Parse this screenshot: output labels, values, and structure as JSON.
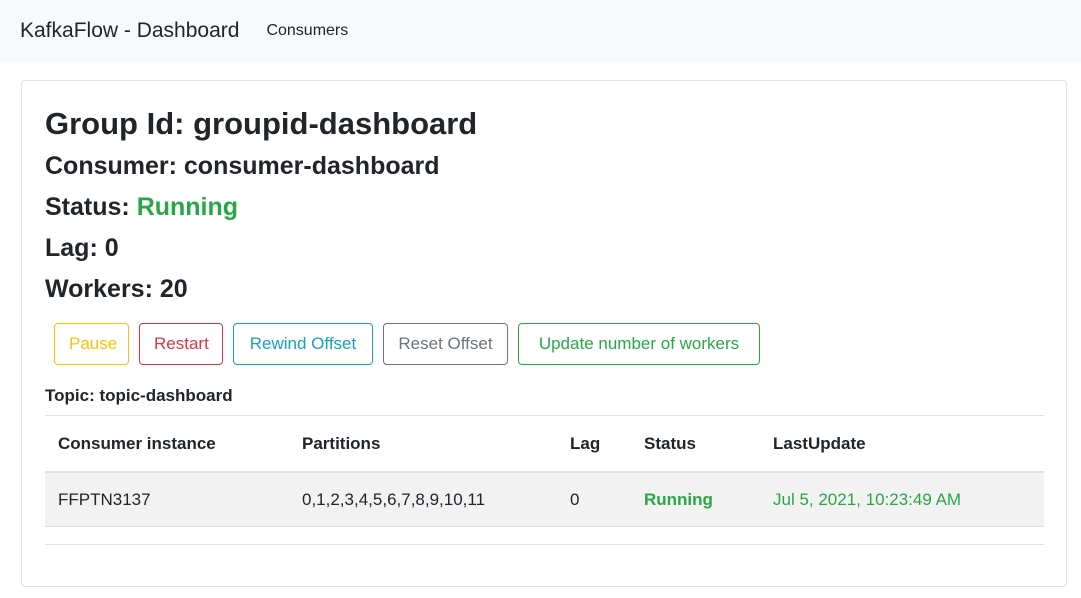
{
  "navbar": {
    "brand": "KafkaFlow - Dashboard",
    "link": "Consumers"
  },
  "consumer": {
    "group_label": "Group Id: ",
    "group_id": "groupid-dashboard",
    "consumer_label": "Consumer: ",
    "consumer_name": "consumer-dashboard",
    "status_label": "Status: ",
    "status": "Running",
    "lag_label": "Lag: ",
    "lag": "0",
    "workers_label": "Workers: ",
    "workers": "20"
  },
  "buttons": {
    "pause": "Pause",
    "restart": "Restart",
    "rewind": "Rewind Offset",
    "reset": "Reset Offset",
    "update_workers": "Update number of workers"
  },
  "topic": {
    "label": "Topic: ",
    "name": "topic-dashboard"
  },
  "table": {
    "headers": [
      "Consumer instance",
      "Partitions",
      "Lag",
      "Status",
      "LastUpdate"
    ],
    "rows": [
      [
        "FFPTN3137",
        "0,1,2,3,4,5,6,7,8,9,10,11",
        "0",
        "Running",
        "Jul 5, 2021, 10:23:49 AM"
      ]
    ]
  },
  "colors": {
    "success": "#28a745",
    "warning": "#ffc107",
    "danger": "#dc3545",
    "info": "#17a2b8",
    "secondary": "#6c757d"
  }
}
